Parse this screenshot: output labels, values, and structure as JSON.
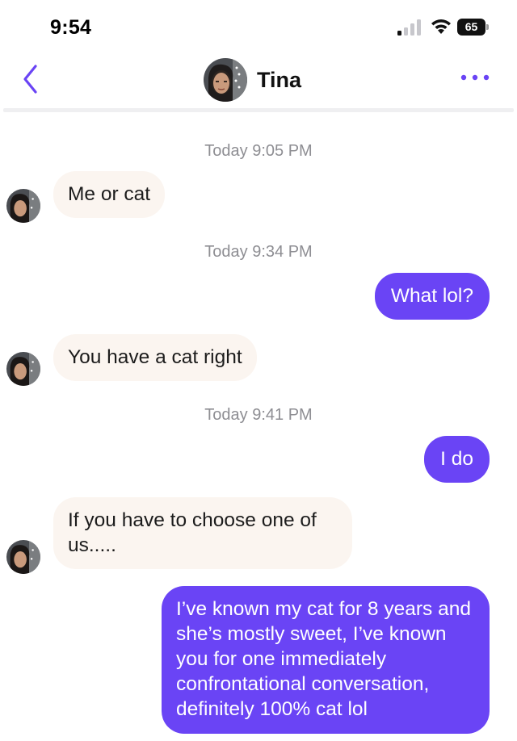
{
  "status_bar": {
    "time": "9:54",
    "battery": "65",
    "icons": [
      "cellular-signal-icon",
      "wifi-icon",
      "battery-icon"
    ]
  },
  "header": {
    "contact_name": "Tina",
    "back_icon": "chevron-left-icon",
    "more_icon": "ellipsis-icon",
    "accent_color": "#6a44f5"
  },
  "conversation": {
    "timestamps": [
      "Today 9:05 PM",
      "Today 9:34 PM",
      "Today 9:41 PM"
    ],
    "messages": [
      {
        "sender": "Tina",
        "direction": "incoming",
        "text": "Me or cat"
      },
      {
        "sender": "me",
        "direction": "outgoing",
        "text": "What lol?"
      },
      {
        "sender": "Tina",
        "direction": "incoming",
        "text": "You have a cat right"
      },
      {
        "sender": "me",
        "direction": "outgoing",
        "text": "I do"
      },
      {
        "sender": "Tina",
        "direction": "incoming",
        "text": "If you have to choose one of us....."
      },
      {
        "sender": "me",
        "direction": "outgoing",
        "text": "I’ve known my cat for 8 years and she’s mostly sweet, I’ve known you for one immediately confrontational conversation, definitely 100% cat lol"
      }
    ]
  },
  "colors": {
    "outgoing_bubble": "#6a44f5",
    "incoming_bubble": "#fbf5f0",
    "timestamp_text": "#8e8e93"
  }
}
